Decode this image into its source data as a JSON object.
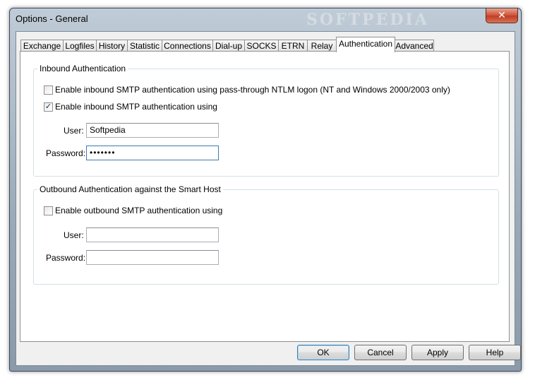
{
  "window": {
    "title": "Options - General",
    "watermark": "SOFTPEDIA",
    "close_glyph": "✕"
  },
  "tabs": [
    {
      "label": "Exchange"
    },
    {
      "label": "Logfiles"
    },
    {
      "label": "History"
    },
    {
      "label": "Statistic"
    },
    {
      "label": "Connections"
    },
    {
      "label": "Dial-up"
    },
    {
      "label": "SOCKS"
    },
    {
      "label": "ETRN"
    },
    {
      "label": "Relay"
    },
    {
      "label": "Authentication",
      "active": true
    },
    {
      "label": "Advanced"
    }
  ],
  "inbound": {
    "legend": "Inbound Authentication",
    "ntlm": {
      "label": "Enable inbound SMTP authentication using pass-through NTLM logon (NT and Windows 2000/2003 only)",
      "checked": false
    },
    "smtp": {
      "label": "Enable inbound SMTP authentication using",
      "checked": true,
      "check_glyph": "✓"
    },
    "user_label": "User:",
    "user_value": "Softpedia",
    "password_label": "Password:",
    "password_value": "•••••••"
  },
  "outbound": {
    "legend": "Outbound Authentication against the Smart Host",
    "smtp": {
      "label": "Enable outbound SMTP authentication using",
      "checked": false
    },
    "user_label": "User:",
    "user_value": "",
    "password_label": "Password:",
    "password_value": ""
  },
  "buttons": {
    "ok": "OK",
    "cancel": "Cancel",
    "apply": "Apply",
    "help": "Help"
  }
}
